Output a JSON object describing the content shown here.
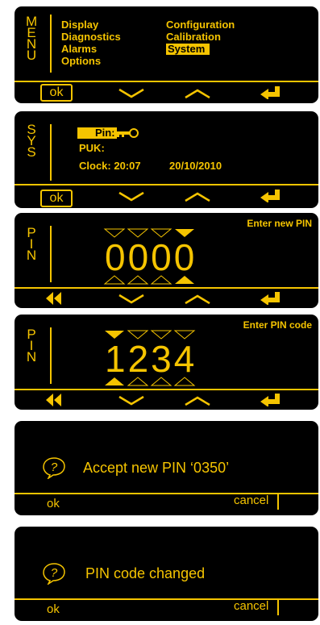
{
  "screens": {
    "menu": {
      "side_letters": [
        "M",
        "E",
        "N",
        "U"
      ],
      "items_left": [
        "Display",
        "Diagnostics",
        "Alarms",
        "Options"
      ],
      "items_right": [
        "Configuration",
        "Calibration",
        "System"
      ],
      "selected": "System",
      "ok_label": "ok"
    },
    "sys": {
      "side_letters": [
        "S",
        "Y",
        "S"
      ],
      "pin_label": "Pin:",
      "puk_label": "PUK:",
      "clock_label": "Clock: 20:07",
      "date_label": "20/10/2010",
      "ok_label": "ok"
    },
    "new_pin": {
      "side_letters": [
        "P",
        "I",
        "N"
      ],
      "title": "Enter new PIN",
      "digits": "0000",
      "active_digit_index": 3
    },
    "pin_code": {
      "side_letters": [
        "P",
        "I",
        "N"
      ],
      "title": "Enter PIN code",
      "digits": "1234",
      "active_digit_index": 0
    },
    "accept": {
      "message": "Accept new PIN ‘0350’",
      "ok_label": "ok",
      "cancel_label": "cancel"
    },
    "changed": {
      "message": "PIN code changed",
      "ok_label": "ok",
      "cancel_label": "cancel"
    }
  },
  "colors": {
    "accent": "#f5c400",
    "screen_bg": "#000000"
  },
  "icons": [
    "chevron-down-icon",
    "chevron-up-icon",
    "enter-icon",
    "rewind-icon",
    "key-icon",
    "question-bubble-icon"
  ]
}
